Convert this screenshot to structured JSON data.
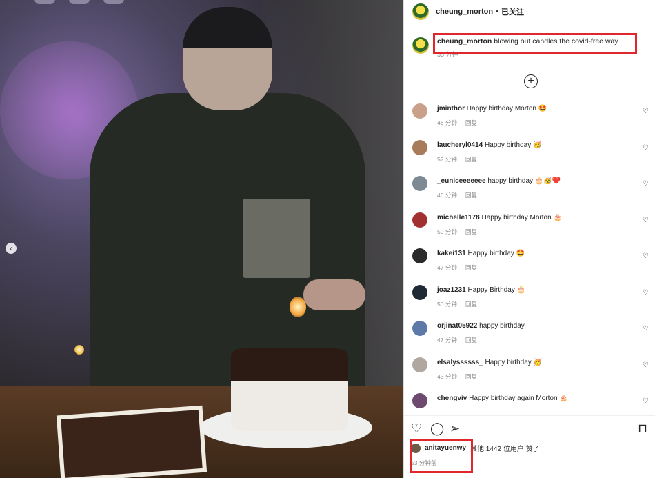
{
  "post": {
    "username": "cheung_morton",
    "separator": "•",
    "follow_status": "已关注",
    "caption_user": "cheung_morton",
    "caption_text": "blowing out candles the covid-free way",
    "caption_time": "53 分钟",
    "load_more_icon": "plus-circle-icon"
  },
  "comments": [
    {
      "user": "jminthor",
      "text": "Happy birthday Morton",
      "emoji": "🤩",
      "time": "46 分钟",
      "reply": "回复",
      "avatar_color": "#c9a08a"
    },
    {
      "user": "laucheryl0414",
      "text": "Happy birthday",
      "emoji": "🥳",
      "time": "52 分钟",
      "reply": "回复",
      "avatar_color": "#a87b5a"
    },
    {
      "user": "_euniceeeeeee",
      "text": "happy birthday",
      "emoji": "🎂🥳❤️",
      "time": "46 分钟",
      "reply": "回复",
      "avatar_color": "#7d8a93"
    },
    {
      "user": "michelle1178",
      "text": "Happy birthday Morton",
      "emoji": "🎂",
      "time": "50 分钟",
      "reply": "回复",
      "avatar_color": "#a33030"
    },
    {
      "user": "kakei131",
      "text": "Happy birthday",
      "emoji": "🤩",
      "time": "47 分钟",
      "reply": "回复",
      "avatar_color": "#2b2b2b"
    },
    {
      "user": "joaz1231",
      "text": "Happy Birthday",
      "emoji": "🎂",
      "time": "50 分钟",
      "reply": "回复",
      "avatar_color": "#1f2a36"
    },
    {
      "user": "orjinat05922",
      "text": "happy birthday",
      "emoji": "",
      "time": "47 分钟",
      "reply": "回复",
      "avatar_color": "#5d79a8"
    },
    {
      "user": "elsalyssssss_",
      "text": "Happy birthday",
      "emoji": "🥳",
      "time": "43 分钟",
      "reply": "回复",
      "avatar_color": "#b0a8a0"
    },
    {
      "user": "chengviv",
      "text": "Happy birthday again Morton",
      "emoji": "🎂",
      "time": "",
      "reply": "",
      "avatar_color": "#6e4a6e"
    }
  ],
  "actions": {
    "like_icon": "heart-icon",
    "comment_icon": "comment-icon",
    "share_icon": "send-icon",
    "save_icon": "bookmark-icon"
  },
  "likes": {
    "user": "anitayuenwy",
    "rest": "其他 1442 位用户 赞了"
  },
  "post_time": "53 分钟前",
  "colors": {
    "highlight": "#e0272d",
    "muted": "#8e8e8e",
    "text": "#262626"
  }
}
